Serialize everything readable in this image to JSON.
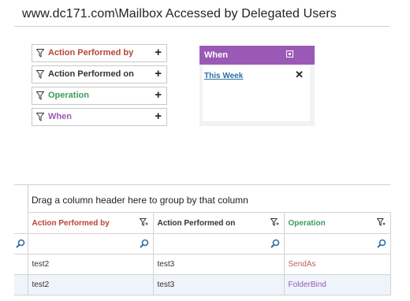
{
  "page": {
    "title": "www.dc171.com\\Mailbox Accessed by Delegated Users"
  },
  "filters": [
    {
      "label": "Action Performed by",
      "color": "#b8433a",
      "icon": "filter-icon",
      "action_icon": "plus-icon"
    },
    {
      "label": "Action Performed on",
      "color": "#333333",
      "icon": "filter-icon",
      "action_icon": "plus-icon"
    },
    {
      "label": "Operation",
      "color": "#3d9c5e",
      "icon": "filter-icon",
      "action_icon": "plus-icon"
    },
    {
      "label": "When",
      "color": "#9b59b6",
      "icon": "filter-icon",
      "action_icon": "plus-icon"
    }
  ],
  "when_panel": {
    "title": "When",
    "header_color": "#9b59b6",
    "selected_value": "This Week",
    "remove_icon": "close-icon"
  },
  "grid": {
    "group_hint": "Drag a column header here to group by that column",
    "columns": [
      {
        "label": "Action Performed by",
        "color": "#b8433a"
      },
      {
        "label": "Action Performed on",
        "color": "#333333"
      },
      {
        "label": "Operation",
        "color": "#3d9c5e"
      }
    ],
    "rows": [
      {
        "by": "test2",
        "on": "test3",
        "operation": "SendAs"
      },
      {
        "by": "test2",
        "on": "test3",
        "operation": "FolderBind"
      }
    ],
    "row_operation_colors": [
      "#c0605a",
      "#9b59b6"
    ]
  }
}
